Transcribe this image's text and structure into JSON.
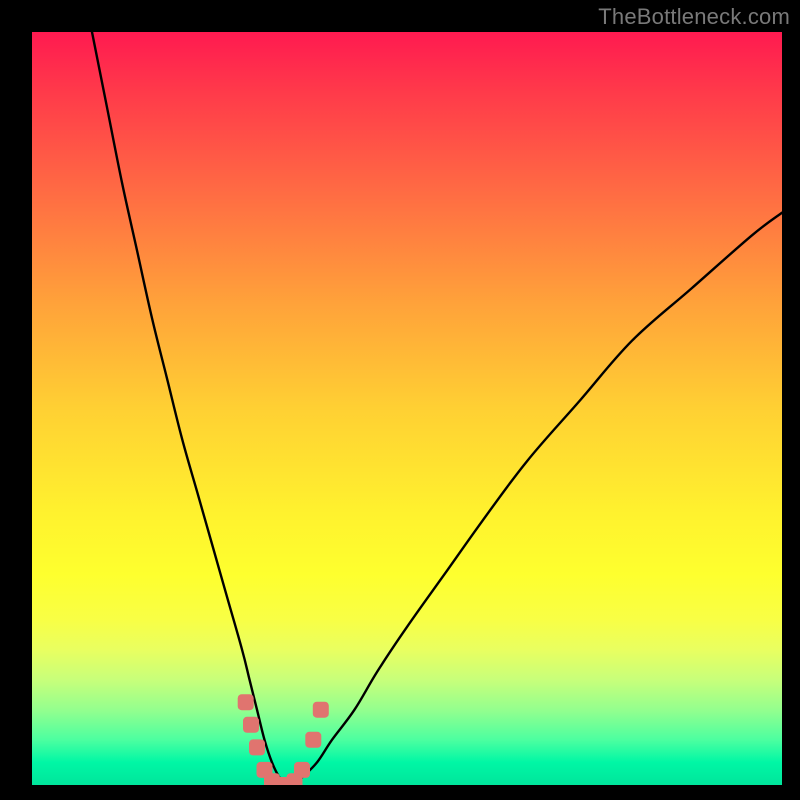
{
  "watermark": {
    "text": "TheBottleneck.com"
  },
  "chart_data": {
    "type": "line",
    "title": "",
    "xlabel": "",
    "ylabel": "",
    "xlim": [
      0,
      100
    ],
    "ylim": [
      0,
      100
    ],
    "grid": false,
    "series": [
      {
        "name": "curve",
        "x": [
          8,
          10,
          12,
          14,
          16,
          18,
          20,
          22,
          24,
          26,
          28,
          29,
          30,
          31,
          32,
          33,
          34,
          35,
          36,
          38,
          40,
          43,
          46,
          50,
          55,
          60,
          66,
          73,
          80,
          88,
          96,
          100
        ],
        "y": [
          100,
          90,
          80,
          71,
          62,
          54,
          46,
          39,
          32,
          25,
          18,
          14,
          10,
          6,
          3,
          1,
          0,
          0,
          1,
          3,
          6,
          10,
          15,
          21,
          28,
          35,
          43,
          51,
          59,
          66,
          73,
          76
        ]
      },
      {
        "name": "markers",
        "x": [
          28.5,
          29.2,
          30.0,
          31.0,
          32.0,
          33.0,
          34.0,
          35.0,
          36.0,
          37.5,
          38.5
        ],
        "y": [
          11,
          8,
          5,
          2,
          0.5,
          0,
          0,
          0.5,
          2,
          6,
          10
        ]
      }
    ],
    "background_gradient": {
      "direction": "vertical",
      "stops": [
        {
          "pos": 0.0,
          "color": "#ff1a50"
        },
        {
          "pos": 0.5,
          "color": "#ffd033"
        },
        {
          "pos": 0.78,
          "color": "#f8ff45"
        },
        {
          "pos": 1.0,
          "color": "#00e59b"
        }
      ]
    }
  }
}
